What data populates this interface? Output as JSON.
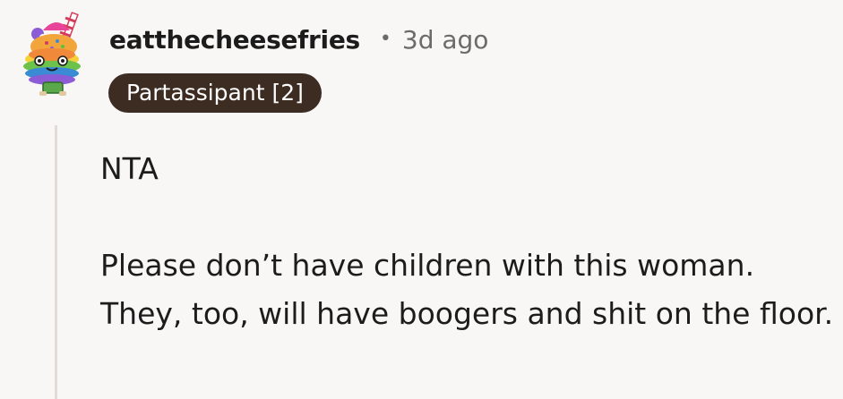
{
  "comment": {
    "username": "eatthecheesefries",
    "separator": "•",
    "timestamp": "3d ago",
    "flair": "Partassipant [2]",
    "paragraphs": [
      "NTA",
      "Please don’t have children with this woman. They, too, will have boogers and shit on the floor."
    ],
    "avatar_icon": "rainbow-cupcake-avatar-icon"
  },
  "colors": {
    "background": "#f9f7f6",
    "flair_background": "#3d2c22",
    "flair_text": "#ffffff",
    "meta_text": "#6b6b6b",
    "thread_line": "#e2dcd8"
  }
}
